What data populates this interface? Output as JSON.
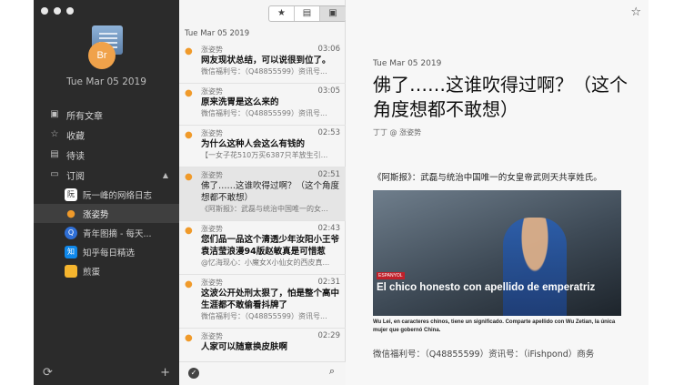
{
  "sidebar": {
    "app_icon_letters": "Br",
    "date": "Tue Mar 05 2019",
    "nav": [
      {
        "label": "所有文章",
        "icon": "inbox-icon"
      },
      {
        "label": "收藏",
        "icon": "star-icon"
      },
      {
        "label": "待读",
        "icon": "document-icon"
      },
      {
        "label": "订阅",
        "icon": "folder-icon"
      }
    ],
    "subscriptions": [
      {
        "label": "阮一峰的网络日志",
        "icon": "ruanyifeng-icon",
        "color": "#ffffff"
      },
      {
        "label": "涨姿势",
        "icon": "flame-icon",
        "color": "#f09a2a"
      },
      {
        "label": "青年图摘 - 每天...",
        "icon": "qingnian-icon",
        "color": "#2f6fd6"
      },
      {
        "label": "知乎每日精选",
        "icon": "zhihu-icon",
        "color": "#0f88eb"
      },
      {
        "label": "煎蛋",
        "icon": "jiandan-icon",
        "color": "#f5b52e"
      }
    ]
  },
  "list": {
    "date": "Tue Mar 05 2019",
    "items": [
      {
        "source": "涨姿势",
        "time": "03:06",
        "title": "网友现状总结，可以说很到位了。",
        "excerpt": "微信福利号：（Q48855599）资讯号..."
      },
      {
        "source": "涨姿势",
        "time": "03:05",
        "title": "原来洗胃是这么来的",
        "excerpt": "微信福利号：（Q48855599）资讯号..."
      },
      {
        "source": "涨姿势",
        "time": "02:53",
        "title": "为什么这种人会这么有钱的",
        "excerpt": "【一女子花510万买6387只羊放生引..."
      },
      {
        "source": "涨姿势",
        "time": "02:51",
        "title": "佛了……这谁吹得过啊？（这个角度想都不敢想）",
        "excerpt": "《阿斯报》：武磊与统治中国唯一的女..."
      },
      {
        "source": "涨姿势",
        "time": "02:43",
        "title": "您们品一品这个清透少年汝阳小王爷袁洁莹浪漫94版赵敏真是可惜惹",
        "excerpt": "@忆海现心：小魔女X小仙女的西皮真..."
      },
      {
        "source": "涨姿势",
        "time": "02:31",
        "title": "这波公开处刑太狠了，怕是整个高中生涯都不敢偷看抖牌了",
        "excerpt": "微信福利号：（Q48855599）资讯号..."
      },
      {
        "source": "涨姿势",
        "time": "02:29",
        "title": "人家可以随意换皮肤啊",
        "excerpt": ""
      }
    ]
  },
  "article": {
    "date": "Tue Mar 05 2019",
    "title": "佛了……这谁吹得过啊？（这个角度想都不敢想）",
    "author": "丁丁 @ 涨姿势",
    "lead": "《阿斯报》：武磊与统治中国唯一的女皇帝武则天共享姓氏。",
    "image_tag": "ESPANYOL",
    "image_headline": "El chico honesto con apellido de emperatriz",
    "image_caption": "Wu Lei, en caracteres chinos, tiene un significado. Comparte apellido con Wu Zetian, la única mujer que gobernó China.",
    "footer": "微信福利号：（Q48855599）资讯号：（iFishpond）商务"
  },
  "toolbar": {
    "icons": [
      "star-icon",
      "document-icon",
      "reader-icon"
    ]
  }
}
